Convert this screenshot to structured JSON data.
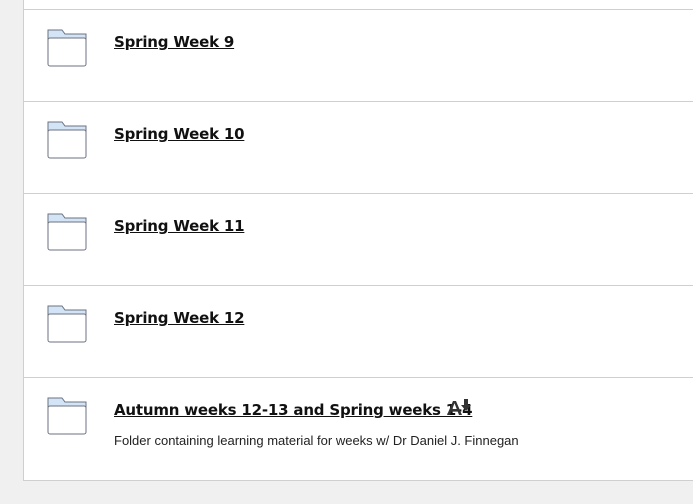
{
  "items": [
    {
      "title": "Spring Week 9",
      "description": "",
      "icon": "folder-icon"
    },
    {
      "title": "Spring Week 10",
      "description": "",
      "icon": "folder-icon"
    },
    {
      "title": "Spring Week 11",
      "description": "",
      "icon": "folder-icon"
    },
    {
      "title": "Spring Week 12",
      "description": "",
      "icon": "folder-icon"
    },
    {
      "title": "Autumn weeks 12-13 and Spring weeks 1-4",
      "description": "Folder containing learning material for weeks w/ Dr Daniel J. Finnegan",
      "icon": "folder-icon",
      "extra_icon": "alternative-formats-icon"
    }
  ],
  "colors": {
    "folder_tab": "#d4e4f7",
    "folder_stroke": "#6b7280",
    "divider": "#cfcfcf"
  }
}
